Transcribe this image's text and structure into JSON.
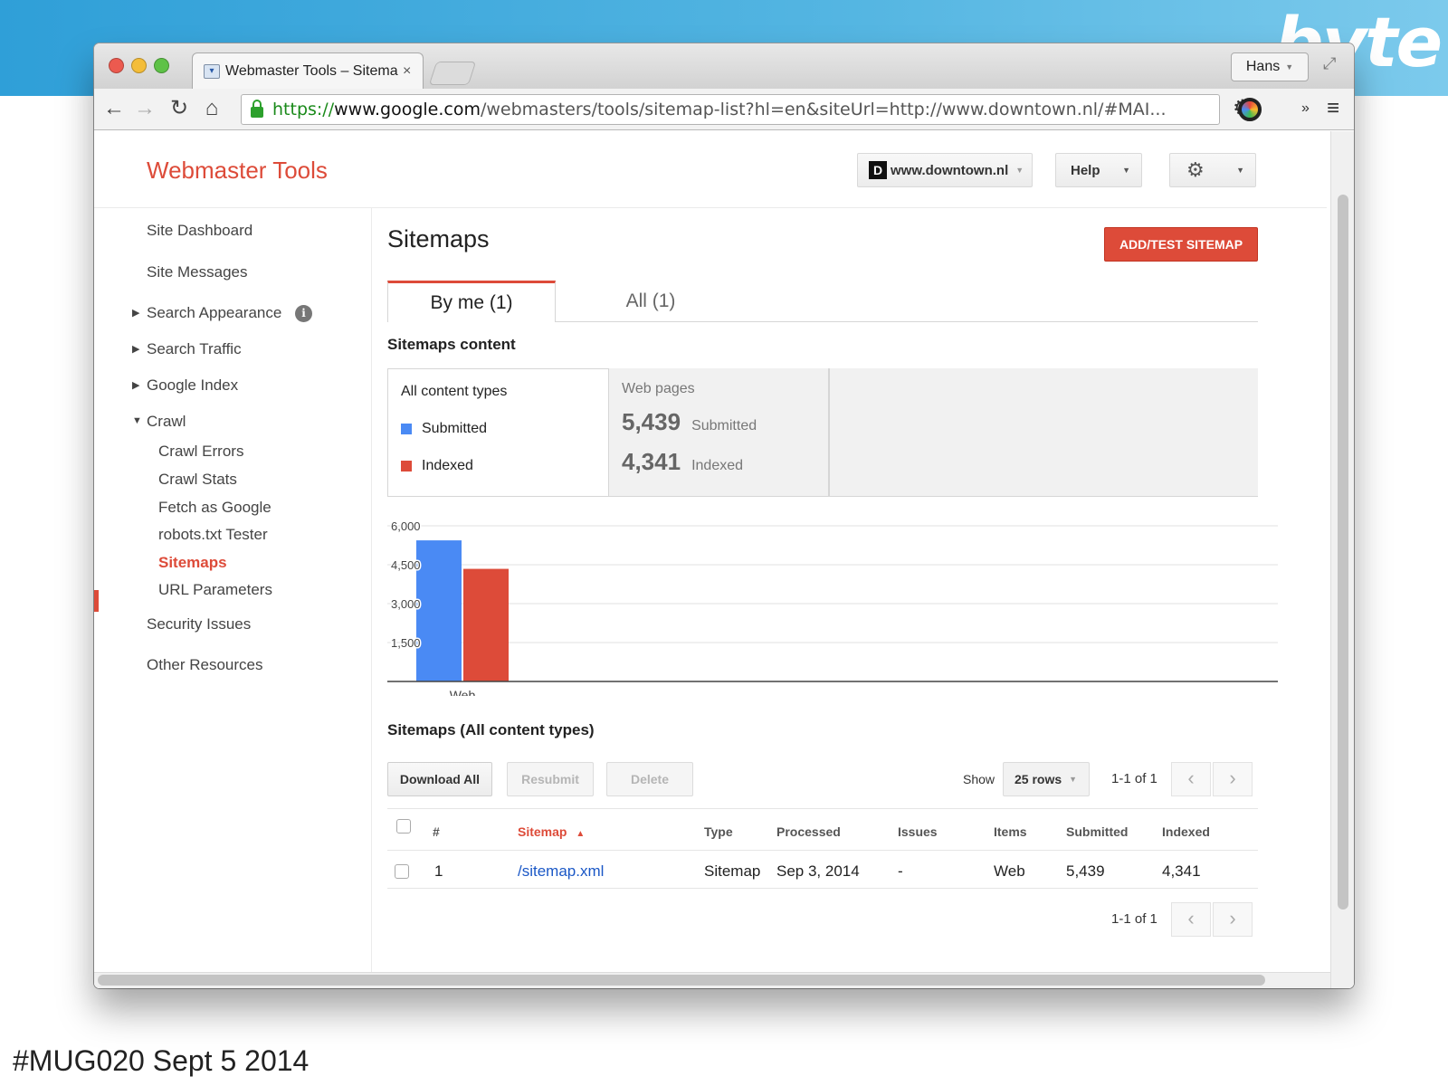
{
  "slide": {
    "brand": "byte",
    "footer": "#MUG020 Sept 5 2014"
  },
  "browser": {
    "tab_title": "Webmaster Tools – Sitema",
    "tab_close": "×",
    "profile": "Hans",
    "url": {
      "scheme": "https://",
      "host": "www.google.com",
      "path": "/webmasters/tools/sitemap-list?hl=en&siteUrl=http://www.downtown.nl/#MAI..."
    }
  },
  "header": {
    "product_title": "Webmaster Tools",
    "site_selector": "www.downtown.nl",
    "site_favicon_letter": "D",
    "help": "Help"
  },
  "sidebar": {
    "items": [
      {
        "label": "Site Dashboard"
      },
      {
        "label": "Site Messages"
      },
      {
        "label": "Search Appearance"
      },
      {
        "label": "Search Traffic"
      },
      {
        "label": "Google Index"
      },
      {
        "label": "Crawl"
      },
      {
        "label": "Crawl Errors"
      },
      {
        "label": "Crawl Stats"
      },
      {
        "label": "Fetch as Google"
      },
      {
        "label": "robots.txt Tester"
      },
      {
        "label": "Sitemaps"
      },
      {
        "label": "URL Parameters"
      },
      {
        "label": "Security Issues"
      },
      {
        "label": "Other Resources"
      }
    ],
    "active": "Sitemaps"
  },
  "main": {
    "title": "Sitemaps",
    "add_button": "ADD/TEST SITEMAP",
    "tabs": [
      {
        "label": "By me (1)",
        "active": true
      },
      {
        "label": "All (1)",
        "active": false
      }
    ],
    "content_heading": "Sitemaps content",
    "legend": {
      "title": "All content types",
      "submitted": "Submitted",
      "indexed": "Indexed"
    },
    "stats": {
      "heading": "Web pages",
      "submitted_value": "5,439",
      "submitted_label": "Submitted",
      "indexed_value": "4,341",
      "indexed_label": "Indexed"
    },
    "table_heading": "Sitemaps (All content types)",
    "actions": {
      "download_all": "Download All",
      "resubmit": "Resubmit",
      "delete": "Delete",
      "show": "Show",
      "rows": "25 rows",
      "pager": "1-1 of 1"
    },
    "table": {
      "columns": [
        "#",
        "Sitemap",
        "Type",
        "Processed",
        "Issues",
        "Items",
        "Submitted",
        "Indexed"
      ],
      "rows": [
        {
          "num": "1",
          "sitemap": "/sitemap.xml",
          "type": "Sitemap",
          "processed": "Sep 3, 2014",
          "issues": "-",
          "items": "Web",
          "submitted": "5,439",
          "indexed": "4,341"
        }
      ]
    }
  },
  "colors": {
    "accent": "#dd4b39",
    "submitted": "#4a8af4",
    "indexed": "#dd4b39",
    "link": "#1a57c6"
  },
  "chart_data": {
    "type": "bar",
    "categories": [
      "Web"
    ],
    "series": [
      {
        "name": "Submitted",
        "values": [
          5439
        ]
      },
      {
        "name": "Indexed",
        "values": [
          4341
        ]
      }
    ],
    "yticks": [
      "1,500",
      "3,000",
      "4,500",
      "6,000"
    ],
    "ylim": [
      0,
      6000
    ],
    "grid": true
  }
}
